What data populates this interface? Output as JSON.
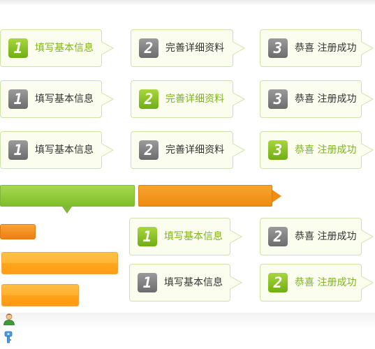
{
  "steps": {
    "row1": [
      {
        "num": "1",
        "label": "填写基本信息",
        "active": true
      },
      {
        "num": "2",
        "label": "完善详细资料",
        "active": false
      },
      {
        "num": "3",
        "label": "恭喜 注册成功",
        "active": false
      }
    ],
    "row2": [
      {
        "num": "1",
        "label": "填写基本信息",
        "active": false
      },
      {
        "num": "2",
        "label": "完善详细资料",
        "active": true
      },
      {
        "num": "3",
        "label": "恭喜 注册成功",
        "active": false
      }
    ],
    "row3": [
      {
        "num": "1",
        "label": "填写基本信息",
        "active": false
      },
      {
        "num": "2",
        "label": "完善详细资料",
        "active": false
      },
      {
        "num": "3",
        "label": "恭喜 注册成功",
        "active": true
      }
    ],
    "row4": [
      {
        "num": "1",
        "label": "填写基本信息",
        "active": true
      },
      {
        "num": "2",
        "label": "恭喜 注册成功",
        "active": false
      }
    ],
    "row5": [
      {
        "num": "1",
        "label": "填写基本信息",
        "active": false
      },
      {
        "num": "2",
        "label": "恭喜 注册成功",
        "active": true
      }
    ]
  },
  "colors": {
    "active_text": "#7db420",
    "inactive_text": "#333333",
    "green_bar": "#8cc63f",
    "orange_bar": "#f39a21"
  },
  "icons": {
    "user": "user-icon",
    "key": "key-icon"
  }
}
